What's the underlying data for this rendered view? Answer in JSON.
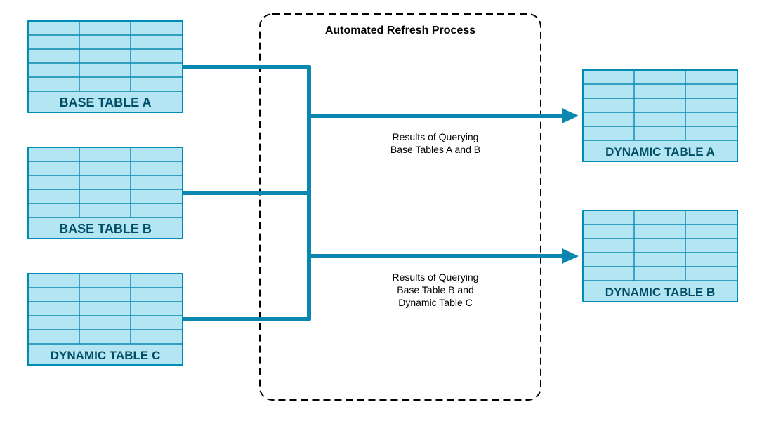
{
  "diagram": {
    "process_title": "Automated Refresh Process",
    "colors": {
      "table_fill": "#b3e5f2",
      "table_border": "#008db5",
      "flow": "#0a87b0",
      "text_dark": "#004d66"
    },
    "tables_left": [
      {
        "label": "BASE TABLE A"
      },
      {
        "label": "BASE TABLE B"
      },
      {
        "label": "DYNAMIC TABLE C"
      }
    ],
    "tables_right": [
      {
        "label": "DYNAMIC TABLE A"
      },
      {
        "label": "DYNAMIC TABLE B"
      }
    ],
    "annotations": {
      "top": {
        "line1": "Results of Querying",
        "line2": "Base Tables A and B"
      },
      "bottom": {
        "line1": "Results of Querying",
        "line2": "Base Table B and",
        "line3": "Dynamic Table C"
      }
    },
    "description": "Three source table icons on the left (Base Table A, Base Table B, Dynamic Table C) feed via thick teal connectors into a dashed rounded rectangle labeled 'Automated Refresh Process'. Inside the process, the top flow (from Base Tables A and B) exits right as an arrow into Dynamic Table A; the bottom flow (from Base Table B and Dynamic Table C) exits right as an arrow into Dynamic Table B. Two text annotations describe each result stream."
  }
}
